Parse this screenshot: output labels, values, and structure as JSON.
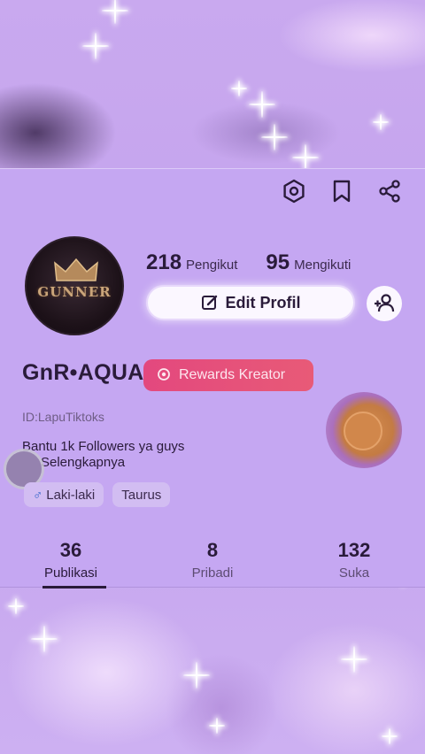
{
  "profile": {
    "followers_count": "218",
    "followers_label": "Pengikut",
    "following_count": "95",
    "following_label": "Mengikuti",
    "edit_label": "Edit Profil",
    "username": "GnR•AQUA",
    "rewards_label": "Rewards Kreator",
    "user_id": "ID:LapuTiktoks",
    "bio": "Bantu 1k Followers ya guys",
    "more_label": "Selengkapnya",
    "avatar_text": "GUNNER",
    "tags": [
      {
        "icon": "male-icon",
        "label": "Laki-laki"
      },
      {
        "label": "Taurus"
      }
    ]
  },
  "tabs": [
    {
      "count": "36",
      "label": "Publikasi",
      "active": true
    },
    {
      "count": "8",
      "label": "Pribadi"
    },
    {
      "count": "132",
      "label": "Suka"
    }
  ],
  "top_icons": [
    "settings-icon",
    "bookmark-icon",
    "share-icon"
  ],
  "colors": {
    "background": "#c5a7f2",
    "rewards": "#e3487e",
    "text": "#2a1b3a"
  }
}
